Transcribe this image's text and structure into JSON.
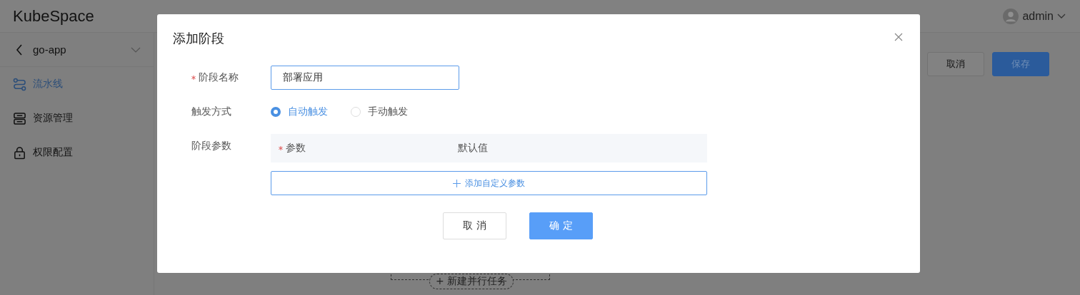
{
  "app": {
    "logo": "KubeSpace",
    "user": "admin"
  },
  "sidebar": {
    "project": "go-app",
    "items": [
      {
        "label": "流水线",
        "selected": true,
        "kind": "pipeline"
      },
      {
        "label": "资源管理",
        "selected": false,
        "kind": "storage"
      },
      {
        "label": "权限配置",
        "selected": false,
        "kind": "lock"
      }
    ]
  },
  "toolbar": {
    "buttons": [
      {
        "label": "取消",
        "kind": "default"
      },
      {
        "label": "保存",
        "kind": "primary"
      }
    ]
  },
  "canvas": {
    "add_parallel": "+ 新建并行任务"
  },
  "dialog": {
    "title": "添加阶段",
    "fields": [
      {
        "label": "阶段名称",
        "required": true,
        "kind": "input",
        "value": "部署应用"
      },
      {
        "label": "触发方式",
        "required": false,
        "kind": "radio",
        "options": [
          {
            "label": "自动触发",
            "selected": true
          },
          {
            "label": "手动触发",
            "selected": false
          }
        ]
      },
      {
        "label": "阶段参数",
        "required": false,
        "kind": "table",
        "columns": [
          {
            "label": "参数",
            "required": true
          },
          {
            "label": "默认值",
            "required": false
          }
        ],
        "add_button": "添加自定义参数"
      }
    ],
    "buttons": [
      {
        "label": "取 消",
        "kind": "default"
      },
      {
        "label": "确 定",
        "kind": "primary"
      }
    ]
  }
}
